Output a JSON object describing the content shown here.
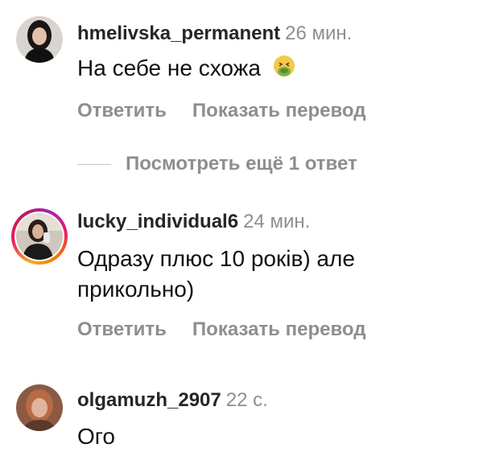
{
  "comments": [
    {
      "username": "hmelivska_permanent",
      "time": "26 мин.",
      "text": "На себе не схожа",
      "emoji": "nauseated-face",
      "reply_label": "Ответить",
      "translate_label": "Показать перевод"
    },
    {
      "username": "lucky_individual6",
      "time": "24 мин.",
      "text": "Одразу плюс 10 років) але прикольно)",
      "reply_label": "Ответить",
      "translate_label": "Показать перевод"
    },
    {
      "username": "olgamuzh_2907",
      "time": "22 с.",
      "text": "Ого"
    }
  ],
  "more_replies": "Посмотреть ещё 1 ответ",
  "colors": {
    "username": "#262626",
    "meta": "#8e8e8e",
    "story_ring": [
      "#f9a825",
      "#e91e63",
      "#9c27b0"
    ]
  }
}
